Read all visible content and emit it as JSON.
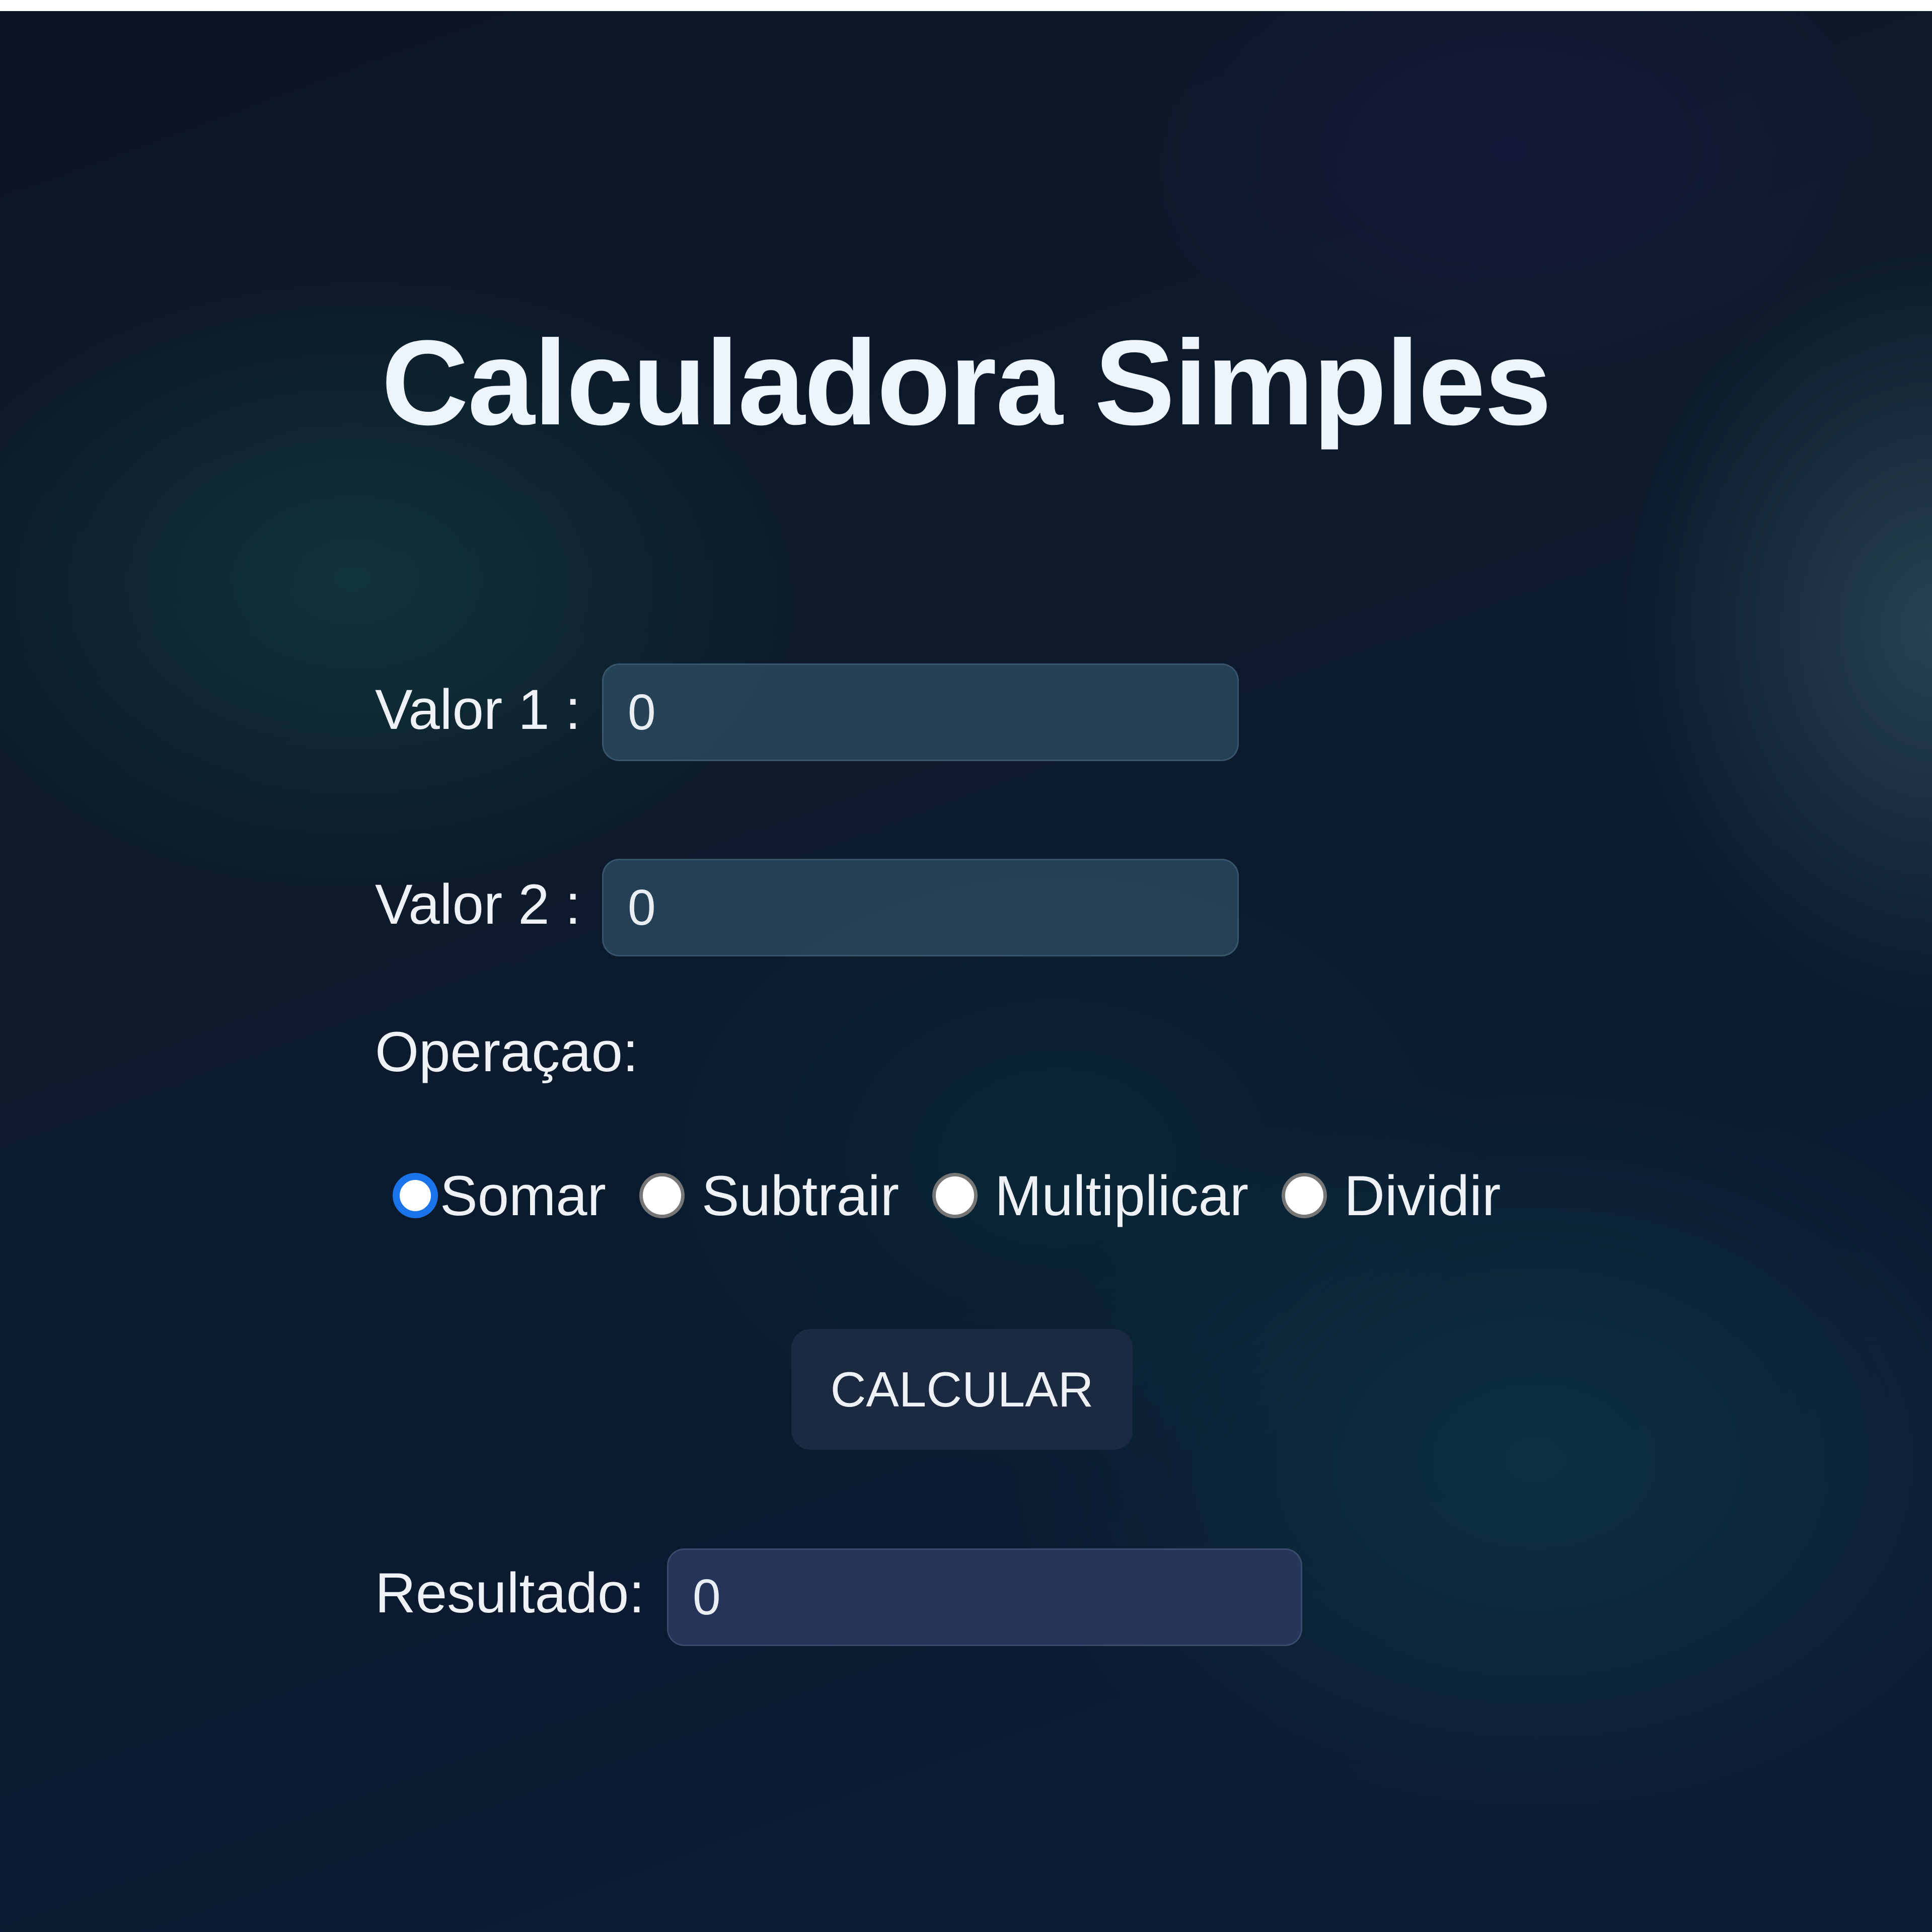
{
  "title": "Calculadora Simples",
  "fields": {
    "valor1": {
      "label": "Valor 1 :",
      "value": "0"
    },
    "valor2": {
      "label": "Valor 2 :",
      "value": "0"
    }
  },
  "operation": {
    "label": "Operaçao:",
    "options": [
      {
        "label": "Somar",
        "checked": true
      },
      {
        "label": "Subtrair",
        "checked": false
      },
      {
        "label": "Multiplicar",
        "checked": false
      },
      {
        "label": "Dividir",
        "checked": false
      }
    ]
  },
  "calculate_button": {
    "label": "CALCULAR"
  },
  "result": {
    "label": "Resultado:",
    "value": "0"
  },
  "colors": {
    "radio_checked": "#1a73e8",
    "button_bg": "#1b2a40"
  }
}
